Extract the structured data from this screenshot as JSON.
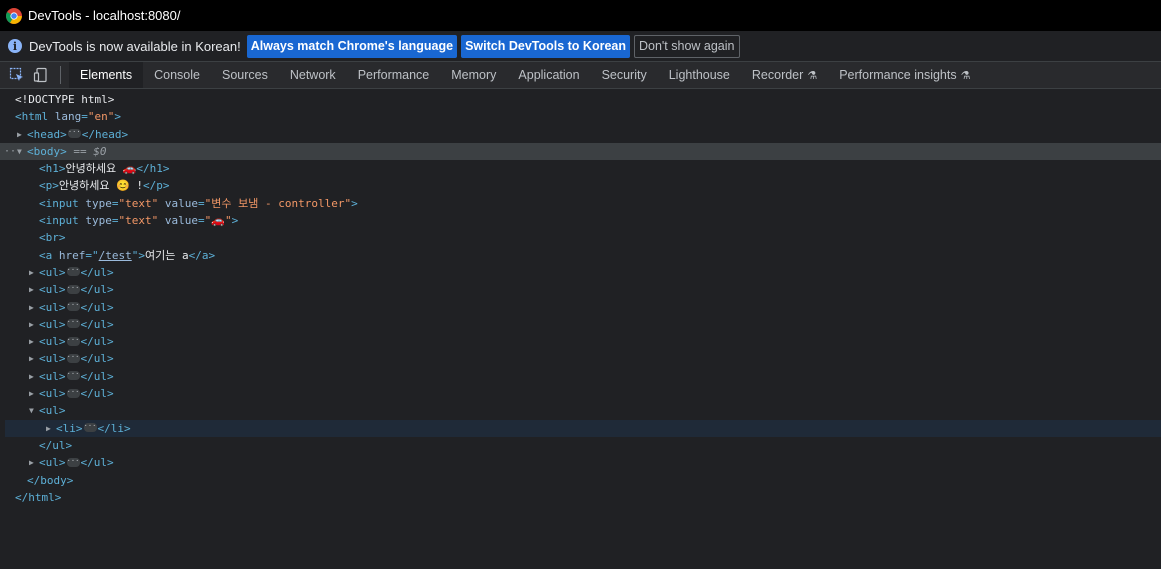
{
  "window": {
    "title": "DevTools - localhost:8080/"
  },
  "infobar": {
    "message": "DevTools is now available in Korean!",
    "buttons": [
      "Always match Chrome's language",
      "Switch DevTools to Korean",
      "Don't show again"
    ]
  },
  "tabs": [
    "Elements",
    "Console",
    "Sources",
    "Network",
    "Performance",
    "Memory",
    "Application",
    "Security",
    "Lighthouse",
    "Recorder",
    "Performance insights"
  ],
  "tree": {
    "doctype": "<!DOCTYPE html>",
    "html_open": "<html",
    "lang_attr": "lang",
    "lang_val": "\"en\"",
    "head": "<head>",
    "head_close": "</head>",
    "body": "<body>",
    "selected_marker": "== $0",
    "h1_open": "<h1>",
    "h1_text": "안녕하세요 🚗",
    "h1_close": "</h1>",
    "p_open": "<p>",
    "p_text": "안녕하세요 😊 !",
    "p_close": "</p>",
    "input_open": "<input",
    "type_attr": "type",
    "type_val": "\"text\"",
    "value_attr": "value",
    "input1_val": "\"변수 보냄 - controller\"",
    "input2_val": "\"🚗\"",
    "input_close": ">",
    "br": "<br>",
    "a_open": "<a",
    "href_attr": "href",
    "href_val": "/test",
    "a_text": "여기는 a",
    "a_close": "</a>",
    "ul_open": "<ul>",
    "ul_close": "</ul>",
    "li_open": "<li>",
    "li_close": "</li>",
    "body_close": "</body>",
    "html_close": "</html>"
  }
}
